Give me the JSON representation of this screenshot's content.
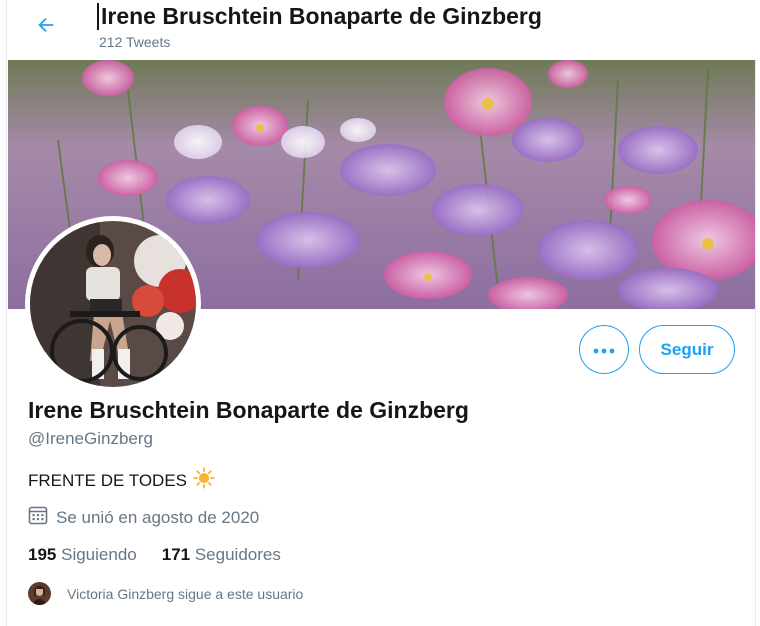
{
  "header": {
    "title": "Irene Bruschtein Bonaparte de Ginzberg",
    "tweet_count": "212 Tweets",
    "back_icon": "arrow-left-icon"
  },
  "colors": {
    "accent": "#1da1f2",
    "text_primary": "#14171a",
    "text_secondary": "#657786"
  },
  "profile": {
    "name": "Irene Bruschtein Bonaparte de Ginzberg",
    "handle": "@IreneGinzberg",
    "bio": "FRENTE DE TODES",
    "bio_emoji": "☀️",
    "joined": "Se unió en agosto de 2020",
    "joined_icon": "calendar-icon"
  },
  "actions": {
    "more_icon": "more-dots-icon",
    "follow_label": "Seguir"
  },
  "stats": {
    "following_count": "195",
    "following_label": "Siguiendo",
    "followers_count": "171",
    "followers_label": "Seguidores"
  },
  "followed_by": {
    "text": "Victoria Ginzberg sigue a este usuario"
  }
}
